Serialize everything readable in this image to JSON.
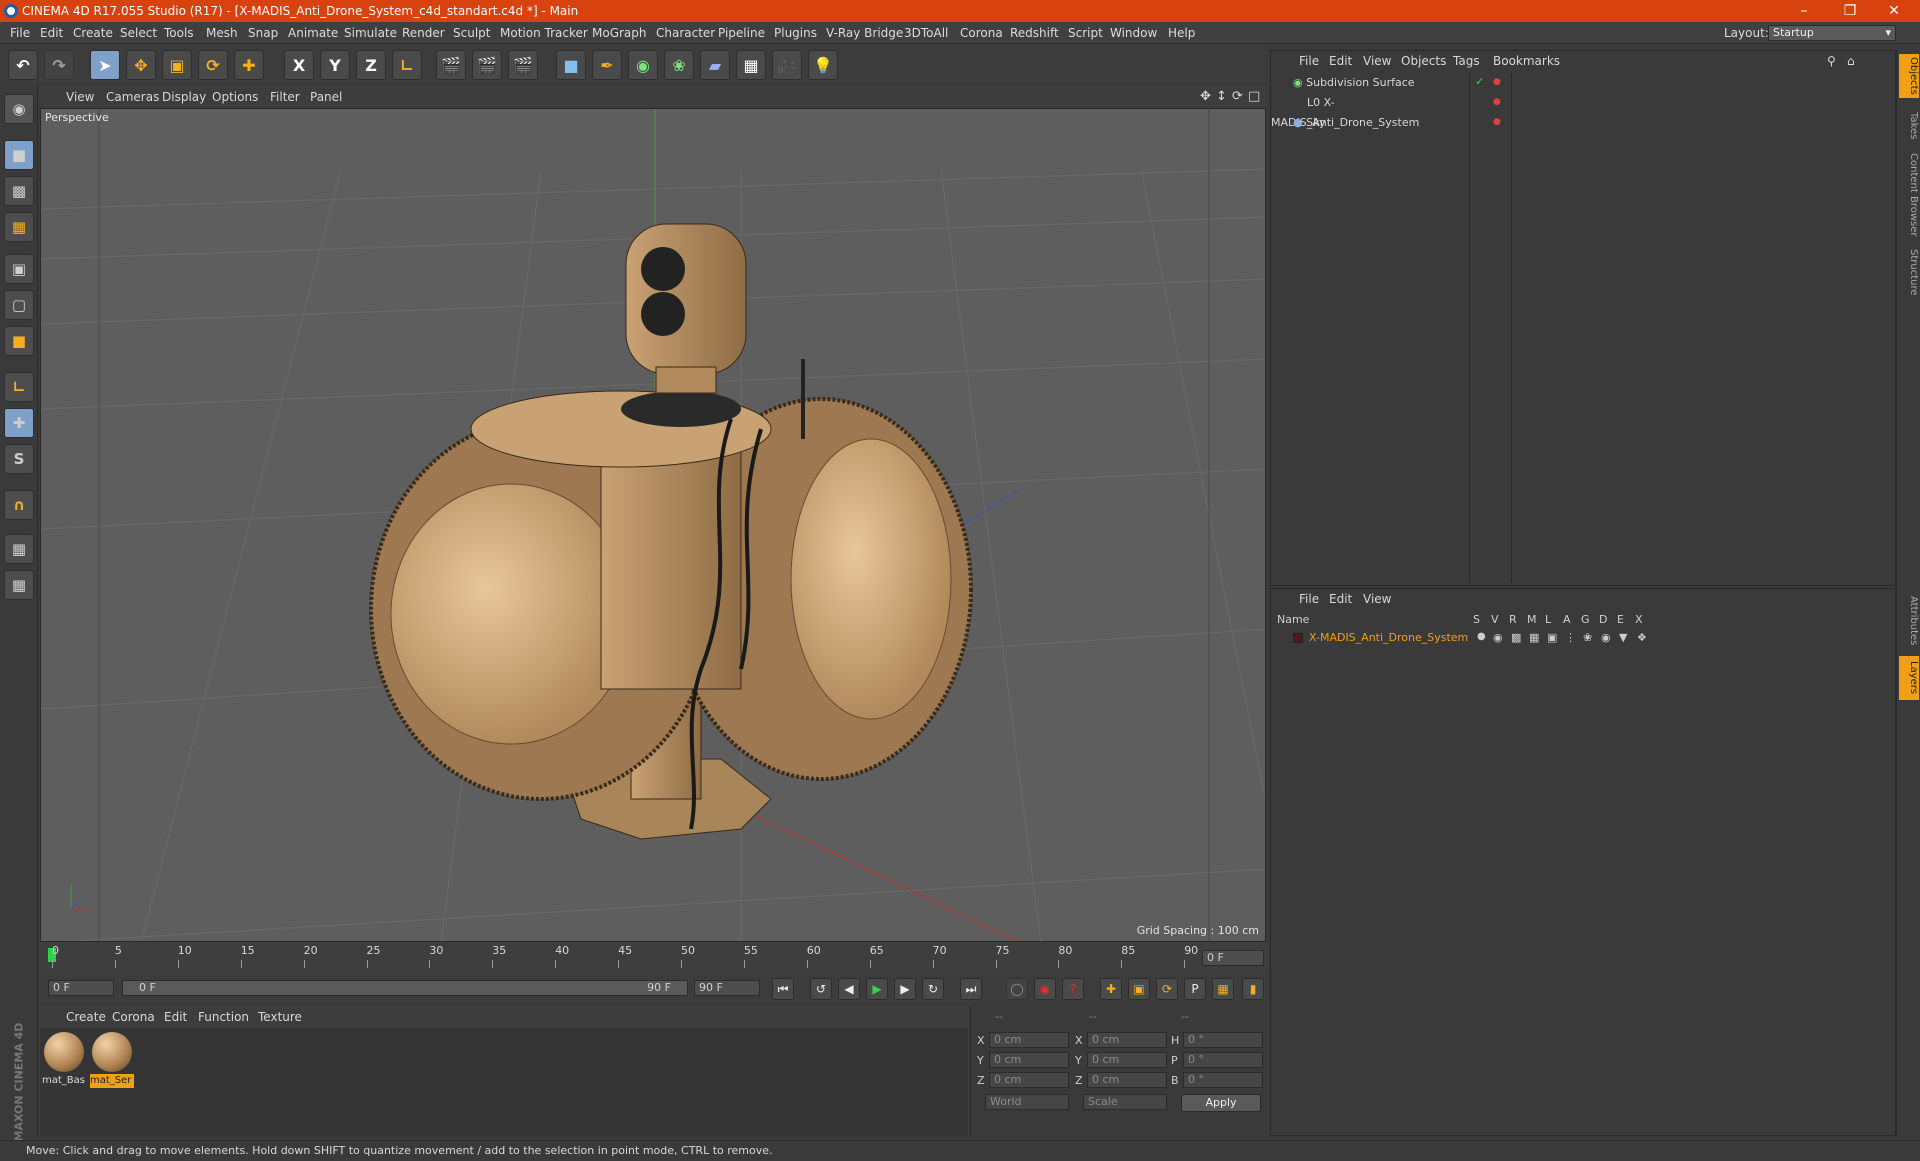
{
  "window": {
    "title": "CINEMA 4D R17.055 Studio (R17) - [X-MADIS_Anti_Drone_System_c4d_standart.c4d *] - Main"
  },
  "menubar": {
    "items": [
      "File",
      "Edit",
      "Create",
      "Select",
      "Tools",
      "Mesh",
      "Snap",
      "Animate",
      "Simulate",
      "Render",
      "Sculpt",
      "Motion Tracker",
      "MoGraph",
      "Character",
      "Pipeline",
      "Plugins",
      "V-Ray Bridge",
      "3DToAll",
      "Corona",
      "Redshift",
      "Script",
      "Window",
      "Help"
    ],
    "layout_label": "Layout:",
    "layout_value": "Startup"
  },
  "toolbar": {
    "x_label": "X",
    "y_label": "Y",
    "z_label": "Z"
  },
  "viewport": {
    "menu": [
      "View",
      "Cameras",
      "Display",
      "Options",
      "Filter",
      "Panel"
    ],
    "label": "Perspective",
    "grid_spacing": "Grid Spacing : 100 cm"
  },
  "timeline": {
    "ticks": [
      "0",
      "5",
      "10",
      "15",
      "20",
      "25",
      "30",
      "35",
      "40",
      "45",
      "50",
      "55",
      "60",
      "65",
      "70",
      "75",
      "80",
      "85",
      "90"
    ],
    "frame_field": "0 F"
  },
  "playbar": {
    "start": "0 F",
    "range_start": "0 F",
    "range_end": "90 F",
    "end": "90 F"
  },
  "materials": {
    "menu": [
      "Create",
      "Corona",
      "Edit",
      "Function",
      "Texture"
    ],
    "items": [
      "mat_Bas",
      "mat_Ser"
    ]
  },
  "coords": {
    "header": [
      "--",
      "--",
      "--"
    ],
    "rows": [
      {
        "a": "X",
        "av": "0 cm",
        "b": "X",
        "bv": "0 cm",
        "c": "H",
        "cv": "0 °"
      },
      {
        "a": "Y",
        "av": "0 cm",
        "b": "Y",
        "bv": "0 cm",
        "c": "P",
        "cv": "0 °"
      },
      {
        "a": "Z",
        "av": "0 cm",
        "b": "Z",
        "bv": "0 cm",
        "c": "B",
        "cv": "0 °"
      }
    ],
    "world": "World",
    "scale": "Scale",
    "apply": "Apply"
  },
  "objects": {
    "menu": [
      "File",
      "Edit",
      "View",
      "Objects",
      "Tags",
      "Bookmarks"
    ],
    "items": [
      "Subdivision Surface",
      "X-MADIS_Anti_Drone_System",
      "Sky"
    ]
  },
  "layers": {
    "menu": [
      "File",
      "Edit",
      "View"
    ],
    "columns": [
      "Name",
      "S",
      "V",
      "R",
      "M",
      "L",
      "A",
      "G",
      "D",
      "E",
      "X"
    ],
    "item": "X-MADIS_Anti_Drone_System"
  },
  "right_tabs": [
    "Objects",
    "Takes",
    "Content Browser",
    "Structure",
    "Attributes",
    "Layers"
  ],
  "maxon": "MAXON CINEMA 4D",
  "status": "Move: Click and drag to move elements. Hold down SHIFT to quantize movement / add to the selection in point mode, CTRL to remove."
}
